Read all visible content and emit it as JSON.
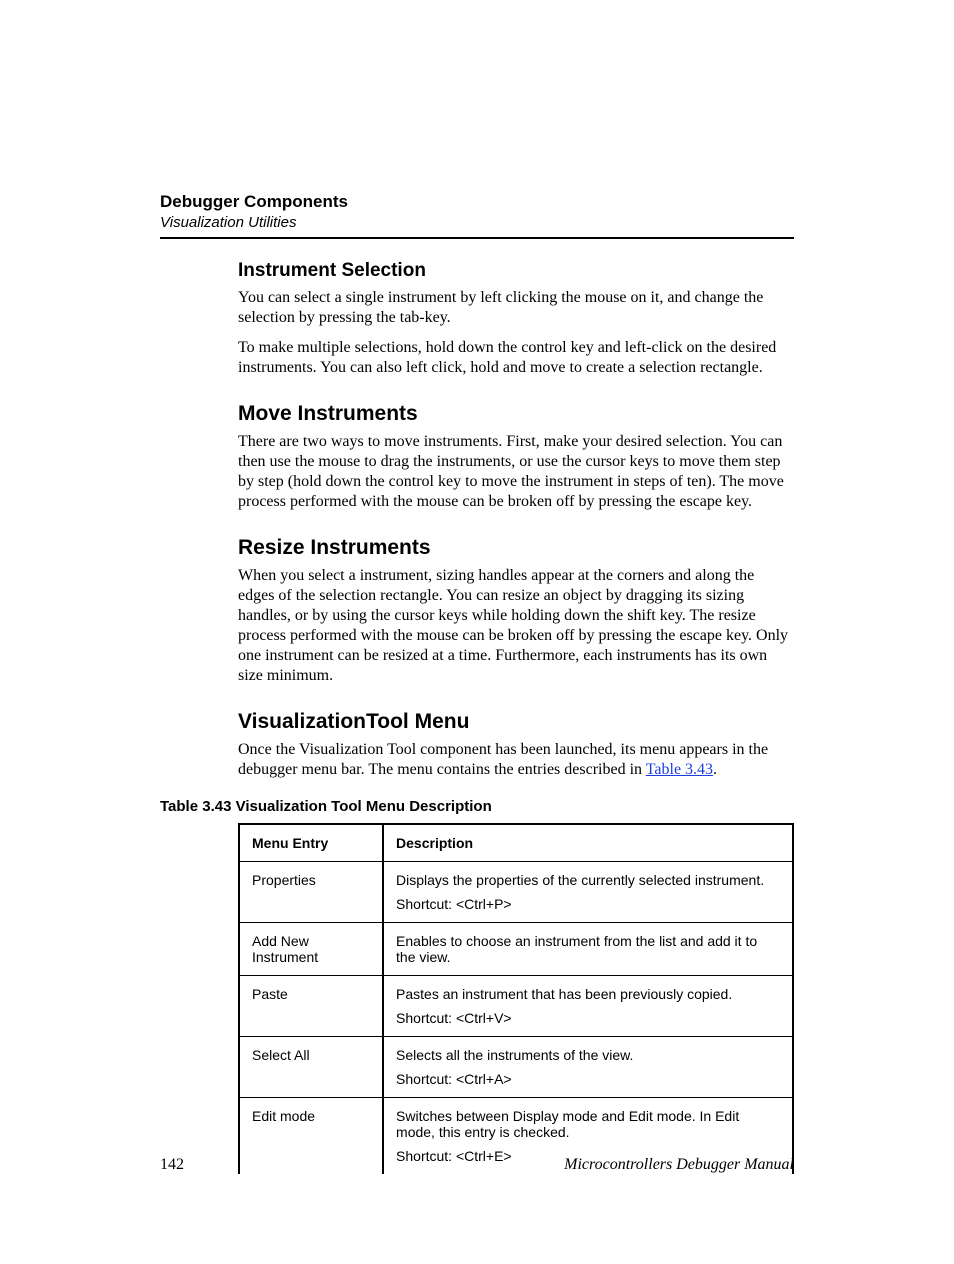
{
  "header": {
    "chapter": "Debugger Components",
    "subsection": "Visualization Utilities"
  },
  "sections": {
    "instrument_selection": {
      "title": "Instrument Selection",
      "p1": "You can select a single instrument by left clicking the mouse on it, and change the selection by pressing the tab-key.",
      "p2": "To make multiple selections, hold down the control key and left-click on the desired instruments. You can also left click, hold and move to create a selection rectangle."
    },
    "move_instruments": {
      "title": "Move Instruments",
      "p1": "There are two ways to move instruments. First, make your desired selection. You can then use the mouse to drag the instruments, or use the cursor keys to move them step by step (hold down the control key to move the instrument in steps of ten). The move process performed with the mouse can be broken off by pressing the escape key."
    },
    "resize_instruments": {
      "title": "Resize Instruments",
      "p1": "When you select a instrument, sizing handles appear at the corners and along the edges of the selection rectangle. You can resize an object by dragging its sizing handles, or by using the cursor keys while holding down the shift key. The resize process performed with the mouse can be broken off by pressing the escape key. Only one instrument can be resized at a time. Furthermore, each instruments has its own size minimum."
    },
    "vt_menu": {
      "title": "VisualizationTool Menu",
      "p1_pre": "Once the Visualization Tool component has been launched, its menu appears in the debugger menu bar. The menu contains the entries described in ",
      "p1_link": "Table 3.43",
      "p1_post": "."
    }
  },
  "table": {
    "caption": "Table 3.43  Visualization Tool Menu Description",
    "headers": {
      "col1": "Menu Entry",
      "col2": "Description"
    },
    "rows": [
      {
        "entry": "Properties",
        "desc": [
          "Displays the properties of the currently selected instrument.",
          "Shortcut: <Ctrl+P>"
        ]
      },
      {
        "entry": "Add New Instrument",
        "desc": [
          "Enables to choose an instrument from the list and add it to the view."
        ]
      },
      {
        "entry": "Paste",
        "desc": [
          "Pastes an instrument that has been previously copied.",
          "Shortcut: <Ctrl+V>"
        ]
      },
      {
        "entry": "Select All",
        "desc": [
          "Selects all the instruments of the view.",
          "Shortcut: <Ctrl+A>"
        ]
      },
      {
        "entry": "Edit mode",
        "desc": [
          "Switches between Display mode and Edit mode. In Edit mode, this entry is checked.",
          "Shortcut: <Ctrl+E>"
        ]
      }
    ]
  },
  "footer": {
    "page_number": "142",
    "manual_title": "Microcontrollers Debugger Manual"
  }
}
